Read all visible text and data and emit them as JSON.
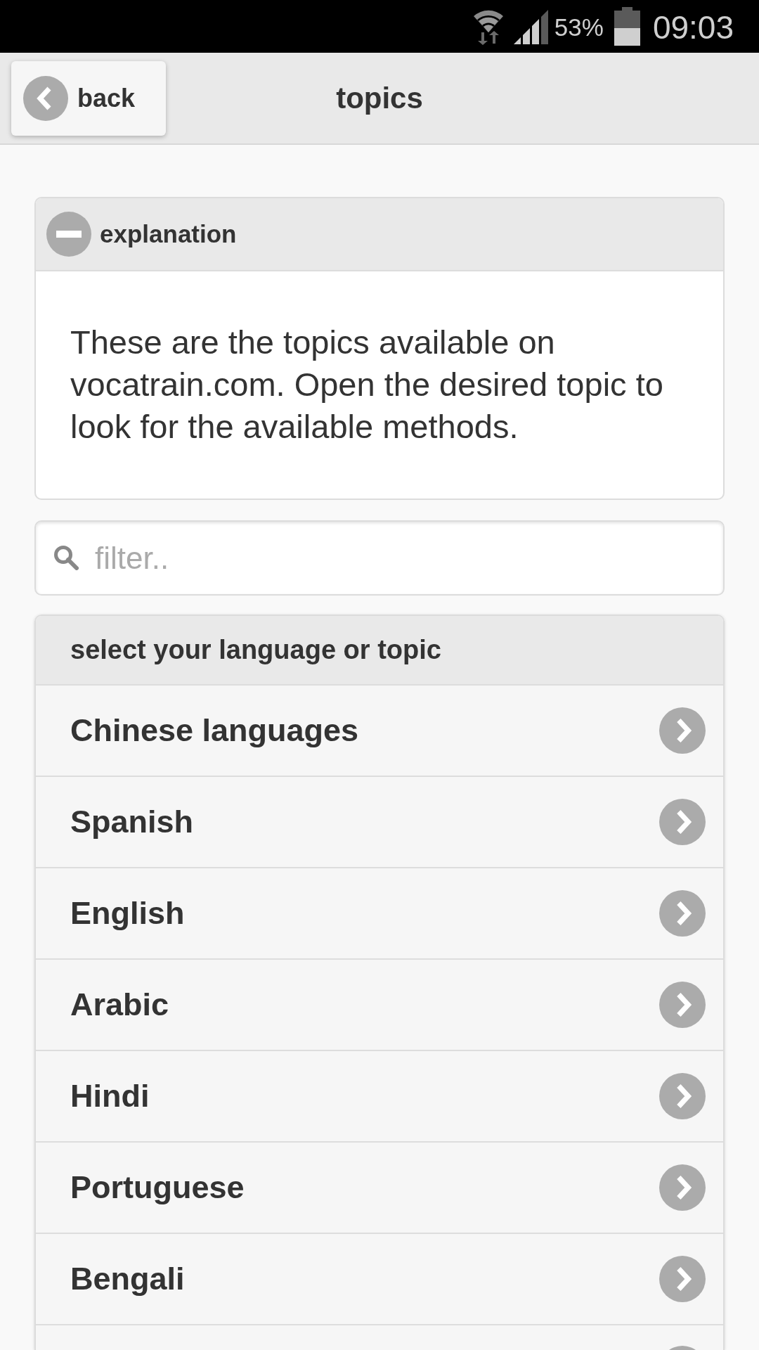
{
  "status_bar": {
    "battery": "53%",
    "time": "09:03"
  },
  "header": {
    "back_button": "back",
    "title": "topics"
  },
  "explanation": {
    "title": "explanation",
    "expanded": true,
    "text": "These are the topics available on vocatrain.com. Open the desired topic to look for the available methods."
  },
  "filter": {
    "placeholder": "filter.."
  },
  "topics": {
    "heading": "select your language or topic",
    "items": [
      {
        "label": "Chinese languages"
      },
      {
        "label": "Spanish"
      },
      {
        "label": "English"
      },
      {
        "label": "Arabic"
      },
      {
        "label": "Hindi"
      },
      {
        "label": "Portuguese"
      },
      {
        "label": "Bengali"
      }
    ],
    "more_below": true
  }
}
